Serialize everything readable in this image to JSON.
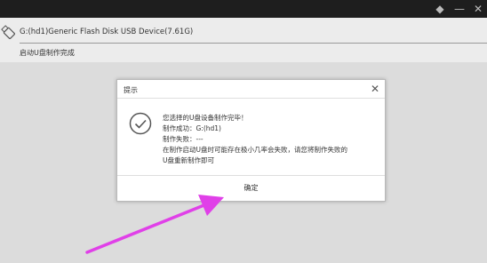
{
  "device": {
    "name": "G:(hd1)Generic Flash Disk USB Device(7.61G)",
    "status": "启动U盘制作完成"
  },
  "dialog": {
    "title": "提示",
    "close_glyph": "✕",
    "message": {
      "line1": "您选择的U盘设备制作完毕！",
      "line2": "制作成功：G:(hd1)",
      "line3": "制作失败：---",
      "line4": "在制作启动U盘时可能存在极小几率会失败，请您将制作失败的",
      "line5": "U盘重新制作即可"
    },
    "ok_label": "确定"
  },
  "icons": {
    "usb": "usb-drive-icon",
    "check": "check-circle-icon",
    "arrow": "pointer-arrow-annotation"
  },
  "colors": {
    "arrow": "#e040e8",
    "titlebar": "#1e1e1e"
  }
}
